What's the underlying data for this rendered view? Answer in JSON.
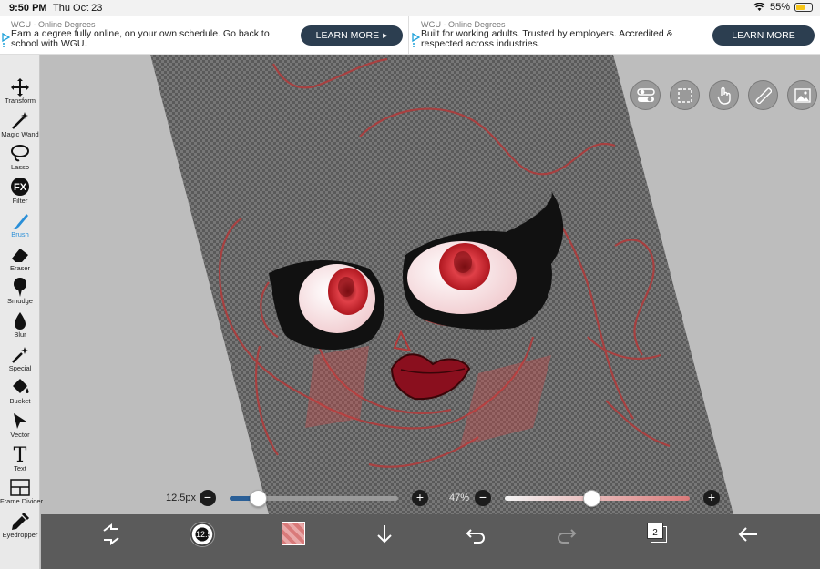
{
  "status_bar": {
    "time": "9:50 PM",
    "date": "Thu Oct 23",
    "battery": "55%",
    "battery_level": 0.55
  },
  "ads": [
    {
      "sponsor": "WGU - Online Degrees",
      "text": "Earn a degree fully online, on your own schedule. Go back to school with WGU.",
      "cta": "LEARN MORE",
      "cta_arrow": "▸"
    },
    {
      "sponsor": "WGU - Online Degrees",
      "text": "Built for working adults. Trusted by employers. Accredited & respected across industries.",
      "cta": "LEARN MORE"
    }
  ],
  "tools": [
    {
      "label": "Transform",
      "icon": "move-arrows-icon"
    },
    {
      "label": "Magic Wand",
      "icon": "magic-wand-icon"
    },
    {
      "label": "Lasso",
      "icon": "lasso-icon"
    },
    {
      "label": "Filter",
      "icon": "fx-icon",
      "glyph": "FX"
    },
    {
      "label": "Brush",
      "icon": "brush-icon",
      "active": true
    },
    {
      "label": "Eraser",
      "icon": "eraser-icon"
    },
    {
      "label": "Smudge",
      "icon": "smudge-icon"
    },
    {
      "label": "Blur",
      "icon": "droplet-icon"
    },
    {
      "label": "Special",
      "icon": "special-brush-icon"
    },
    {
      "label": "Bucket",
      "icon": "bucket-icon"
    },
    {
      "label": "Vector",
      "icon": "pointer-arrow-icon"
    },
    {
      "label": "Text",
      "icon": "text-icon",
      "glyph": "T"
    },
    {
      "label": "Frame Divider",
      "icon": "frame-divider-icon"
    },
    {
      "label": "Eyedropper",
      "icon": "eyedropper-icon"
    }
  ],
  "sliders": {
    "brush_size": {
      "label": "12.5px",
      "minus": "−",
      "plus": "+",
      "value": 0.17
    },
    "opacity": {
      "label": "47%",
      "minus": "−",
      "plus": "+",
      "value": 0.47
    }
  },
  "bottom_bar": {
    "brush_preview_value": "12.5",
    "layers_count": "2"
  },
  "colors": {
    "accent": "#2a8fd8",
    "brush_color": "#d97a7a",
    "slider_fill": "#2a5f97"
  }
}
